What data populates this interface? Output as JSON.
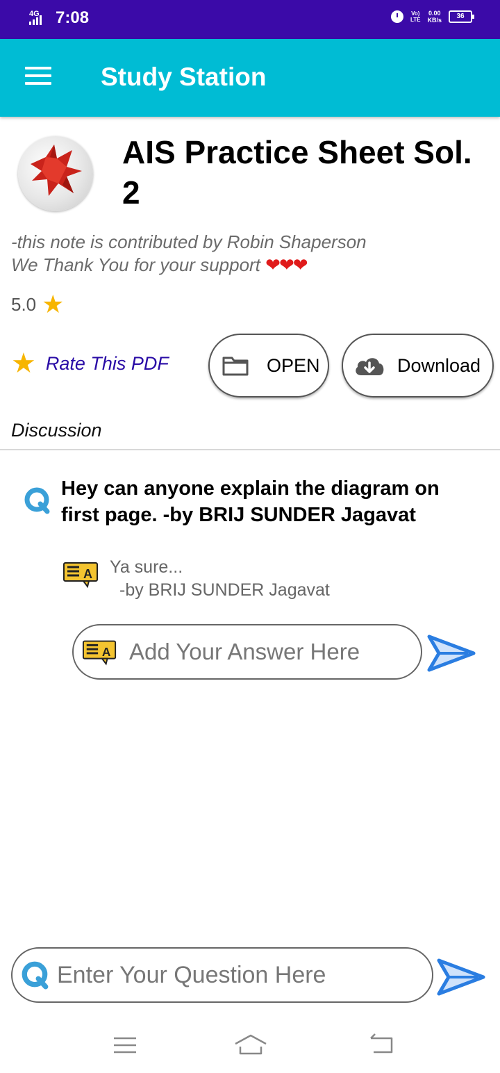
{
  "status_bar": {
    "network": "4G",
    "time": "7:08",
    "volte_top": "Vo)",
    "volte_bottom": "LTE",
    "speed_value": "0.00",
    "speed_unit": "KB/s",
    "battery": "36"
  },
  "app_bar": {
    "title": "Study Station",
    "menu_icon": "hamburger-menu-icon"
  },
  "document": {
    "title": "AIS Practice Sheet Sol. 2",
    "contributor_line": "-this note is contributed by Robin Shaperson",
    "thanks_line": "We Thank You for your support",
    "hearts": "❤❤❤",
    "rating": "5.0",
    "rate_label": "Rate This PDF",
    "open_label": "OPEN",
    "download_label": "Download"
  },
  "discussion": {
    "label": "Discussion",
    "question": "Hey can anyone explain the diagram on first page.  -by BRIJ SUNDER Jagavat",
    "answers": [
      {
        "text": "Ya sure...",
        "author": "-by BRIJ SUNDER Jagavat"
      }
    ],
    "answer_placeholder": "Add Your Answer Here"
  },
  "question_input": {
    "placeholder": "Enter Your Question Here"
  },
  "colors": {
    "status_bar": "#3b0aa8",
    "app_bar": "#00bcd4",
    "rate_label": "#2a0ca6",
    "send_arrow": "#2a7de1",
    "star": "#f7b500"
  }
}
